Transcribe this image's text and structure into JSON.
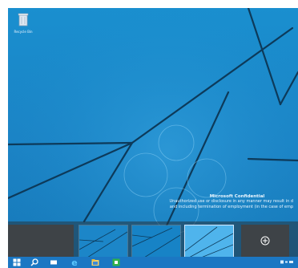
{
  "desktop": {
    "recycle_bin_label": "Recycle Bin"
  },
  "watermark": {
    "title": "Microsoft Confidential",
    "line1": "Unauthorized use or disclosure in any manner may result in d",
    "line2": "and including termination of employment (in the case of emp"
  },
  "task_view": {
    "new_desktop_symbol": "⊕"
  },
  "taskbar": {
    "items": [
      "start-icon",
      "search-icon",
      "task-view-icon",
      "internet-explorer-icon",
      "file-explorer-icon",
      "store-icon"
    ]
  },
  "colors": {
    "wallpaper": "#1a8fcf",
    "taskbar": "#1b77c3",
    "panel": "#3e4347"
  }
}
